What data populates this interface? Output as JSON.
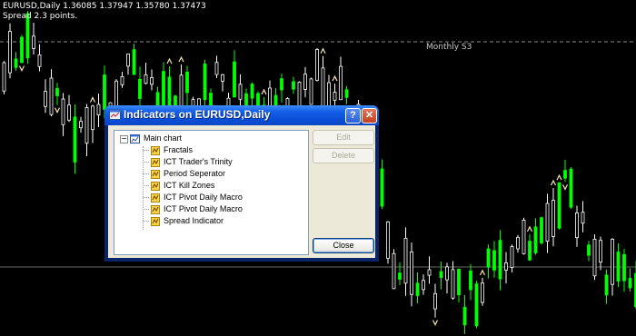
{
  "chart": {
    "symbol_line": "EURUSD,Daily  1.36085 1.37947 1.35780 1.37473",
    "spread_line": "Spread 2.3 points.",
    "level_label": "Monthly S3",
    "background_color": "#000000",
    "bull_candle_color": "#00ff00",
    "fractal_color": "#f5e7b0"
  },
  "dialog": {
    "title": "Indicators on EURUSD,Daily",
    "help_label": "?",
    "close_label": "✕",
    "tree": {
      "root": "Main chart",
      "items": [
        "Fractals",
        "ICT Trader's Trinity",
        "Period Seperator",
        "ICT Kill Zones",
        "ICT Pivot Daily Macro",
        "ICT Pivot Daily Macro",
        "Spread Indicator"
      ]
    },
    "buttons": {
      "edit": "Edit",
      "delete": "Delete",
      "close": "Close"
    }
  }
}
